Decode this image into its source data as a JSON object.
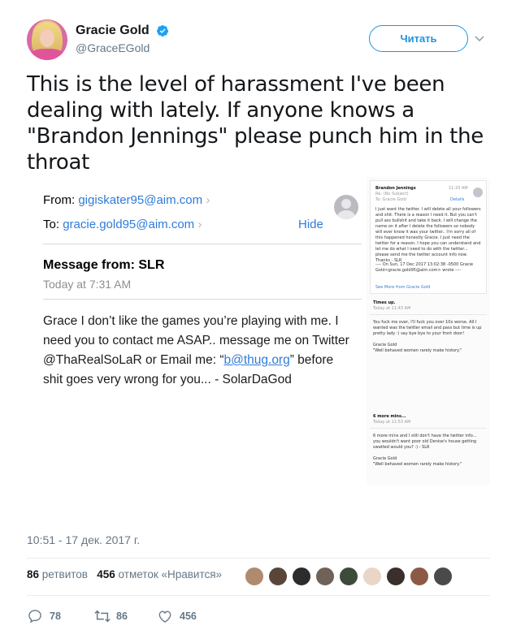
{
  "author": {
    "display_name": "Gracie Gold",
    "handle": "@GraceEGold",
    "verified": true
  },
  "follow_button": "Читать",
  "tweet": {
    "text": "This is the level of harassment I've been dealing with lately. If anyone knows a \"Brandon Jennings\" please punch him in the throat"
  },
  "email": {
    "from_label": "From:",
    "from_value": "gigiskater95@aim.com",
    "to_label": "To:",
    "to_value": "gracie.gold95@aim.com",
    "hide_label": "Hide",
    "subject": "Message from: SLR",
    "time": "Today at 7:31 AM",
    "body_before_link": "Grace I don’t like the games you’re playing with me. I need you to contact me ASAP.. message me on Twitter @ThaRealSoLaR or Email me: “",
    "body_link": "b@thug.org",
    "body_after_link": "” before shit goes very wrong for you... - SolarDaGod"
  },
  "side_email": {
    "sender": "Brandon Jennings",
    "re": "Re: (No Subject)",
    "to": "To: Gracie Gold",
    "time": "11:33 AM",
    "details": "Details",
    "body": "I just want the twitter. I will delete all your followers and shit. There is a reason I need it. But you can't pull ass bullshit and take it back. I will change the name on it after I delete the followers so nobody will ever know it was your twitter.. I'm sorry all of this happened honestly Gracie. I just need the twitter for a reason. I hope you can understand and let me do what I need to do with the twitter... please send me the twitter account info now. Thanks - SLR",
    "quote": "---- On Sun, 17 Dec 2017 13:02:38 -0500 Gracie Gold<gracie.gold95@aim.com> wrote ----",
    "see_more": "See More from Gracie Gold",
    "m2_subject": "Times up.",
    "m2_time": "Today at 11:43 AM",
    "m2_body": "You fuck me over, I'll fuck you over 10x worse. All I wanted was the twitter email and pass but time is up pretty lady :) say bye bye to your front door!",
    "m2_sig1": "Gracie Gold",
    "m2_sig2": "\"Well behaved women rarely make history.\"",
    "m3_subject": "6 more mins...",
    "m3_time": "Today at 11:53 AM",
    "m3_body": "6 more mins and I still don't have the twitter info... you wouldn't want poor old Denise's house getting swatted would you? :) - SLR",
    "m3_sig1": "Gracie Gold",
    "m3_sig2": "\"Well behaved women rarely make history.\""
  },
  "timestamp": "10:51 - 17 дек. 2017 г.",
  "stats": {
    "retweets_count": "86",
    "retweets_label": "ретвитов",
    "likes_count": "456",
    "likes_label": "отметок «Нравится»"
  },
  "actions": {
    "replies": "78",
    "retweets": "86",
    "likes": "456"
  },
  "colors": {
    "accent": "#1b95e0",
    "text": "#14171a",
    "muted": "#657786",
    "link": "#2f7bd9"
  },
  "icons": [
    "verified-icon",
    "chevron-down-icon",
    "reply-icon",
    "retweet-icon",
    "like-icon"
  ]
}
